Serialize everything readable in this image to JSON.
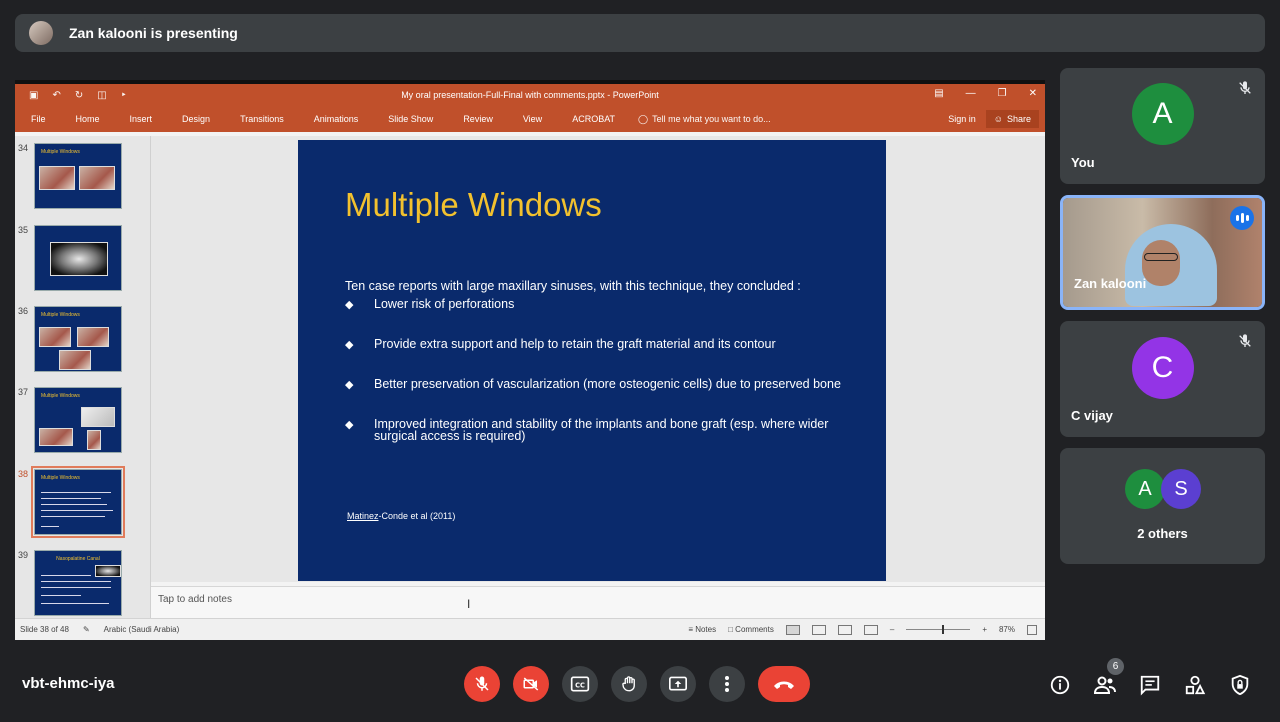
{
  "presenting_bar": {
    "text": "Zan kalooni is presenting"
  },
  "powerpoint": {
    "doc_title": "My oral presentation-Full-Final with comments.pptx - PowerPoint",
    "tabs": [
      "File",
      "Home",
      "Insert",
      "Design",
      "Transitions",
      "Animations",
      "Slide Show",
      "Review",
      "View",
      "ACROBAT"
    ],
    "tell_me": "Tell me what you want to do...",
    "sign_in": "Sign in",
    "share": "Share",
    "thumbnails": [
      {
        "num": "34",
        "title": "Multiple Windows"
      },
      {
        "num": "35",
        "title": ""
      },
      {
        "num": "36",
        "title": "Multiple Windows"
      },
      {
        "num": "37",
        "title": "Multiple Windows"
      },
      {
        "num": "38",
        "title": "Multiple Windows"
      },
      {
        "num": "39",
        "title": "Nasopalatine Canal"
      }
    ],
    "slide": {
      "title": "Multiple Windows",
      "intro": "Ten case reports with large maxillary sinuses, with this technique, they concluded :",
      "bullets": [
        "Lower risk of perforations",
        "Provide extra support and help to retain the graft material and its contour",
        "Better preservation of vascularization (more osteogenic cells) due to preserved bone",
        "Improved integration and stability of the implants and bone graft (esp. where wider surgical access is required)"
      ],
      "ref_underlined": "Matinez",
      "ref_rest": "-Conde  et al (2011)"
    },
    "notes_placeholder": "Tap to add notes",
    "status": {
      "slide_info": "Slide 38 of 48",
      "language": "Arabic (Saudi Arabia)",
      "notes": "Notes",
      "comments": "Comments",
      "zoom": "87%"
    }
  },
  "participants": [
    {
      "initial": "A",
      "name": "You",
      "color": "#1e8e3e"
    },
    {
      "name": "Zan kalooni"
    },
    {
      "initial": "C",
      "name": "C vijay",
      "color": "#9334e6"
    }
  ],
  "others": {
    "initials": [
      "A",
      "S"
    ],
    "colors": [
      "#1e8e3e",
      "#5b3fd1"
    ],
    "label": "2 others"
  },
  "meeting": {
    "code": "vbt-ehmc-iya",
    "people_count": "6"
  }
}
